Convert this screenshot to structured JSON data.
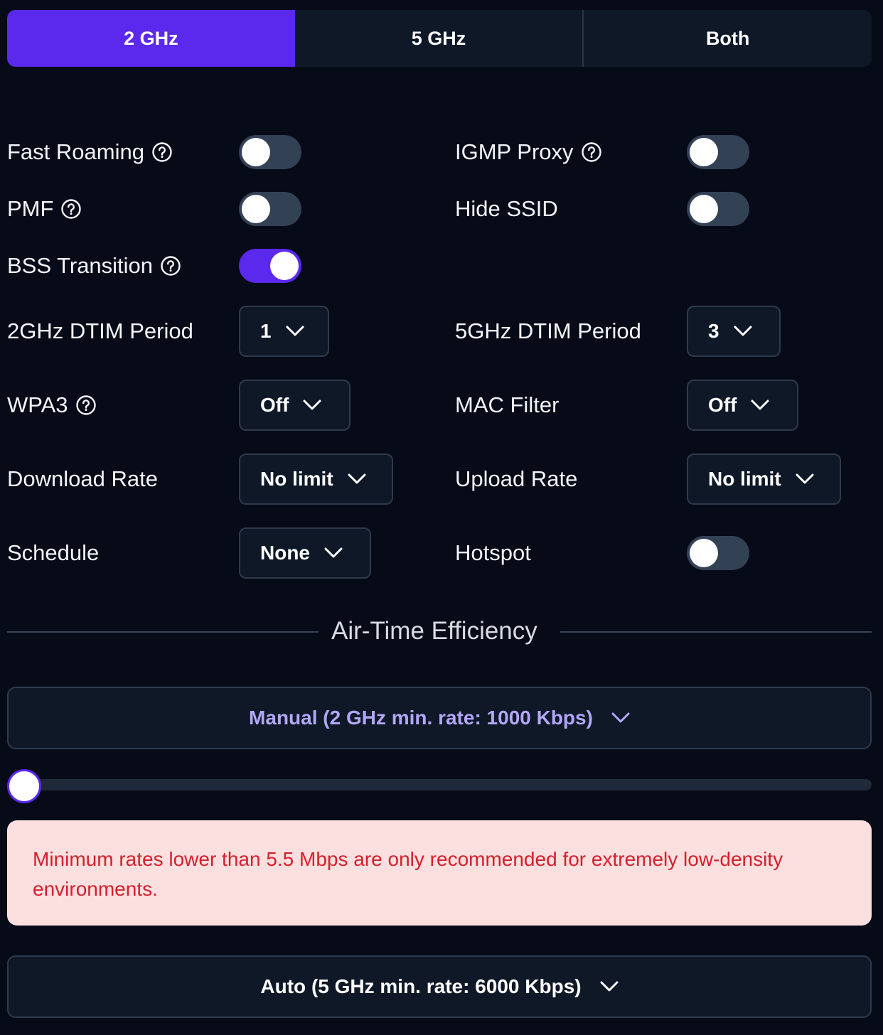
{
  "tabs": [
    {
      "label": "2 GHz",
      "active": true
    },
    {
      "label": "5 GHz",
      "active": false
    },
    {
      "label": "Both",
      "active": false
    }
  ],
  "settings": {
    "fast_roaming": {
      "label": "Fast Roaming",
      "enabled": false
    },
    "igmp_proxy": {
      "label": "IGMP Proxy",
      "enabled": false
    },
    "pmf": {
      "label": "PMF",
      "enabled": false
    },
    "hide_ssid": {
      "label": "Hide SSID",
      "enabled": false
    },
    "bss_transition": {
      "label": "BSS Transition",
      "enabled": true
    },
    "dtim_2ghz": {
      "label": "2GHz DTIM Period",
      "value": "1"
    },
    "dtim_5ghz": {
      "label": "5GHz DTIM Period",
      "value": "3"
    },
    "wpa3": {
      "label": "WPA3",
      "value": "Off"
    },
    "mac_filter": {
      "label": "MAC Filter",
      "value": "Off"
    },
    "download_rate": {
      "label": "Download Rate",
      "value": "No limit"
    },
    "upload_rate": {
      "label": "Upload Rate",
      "value": "No limit"
    },
    "schedule": {
      "label": "Schedule",
      "value": "None"
    },
    "hotspot": {
      "label": "Hotspot",
      "enabled": false
    }
  },
  "air_time": {
    "title": "Air-Time Efficiency",
    "mode_2ghz": "Manual (2 GHz min. rate: 1000 Kbps)",
    "slider_fraction": 0.0,
    "warning": "Minimum rates lower than 5.5 Mbps are only recommended for extremely low-density environments.",
    "mode_5ghz": "Auto (5 GHz min. rate: 6000 Kbps)"
  },
  "colors": {
    "accent": "#5b28ee",
    "accent_text": "#b3a6f7",
    "background": "#070b18",
    "warning_bg": "#fce0e0",
    "warning_text": "#d4202e"
  },
  "icons": {
    "help": "question-circle",
    "dropdown": "chevron-down"
  }
}
